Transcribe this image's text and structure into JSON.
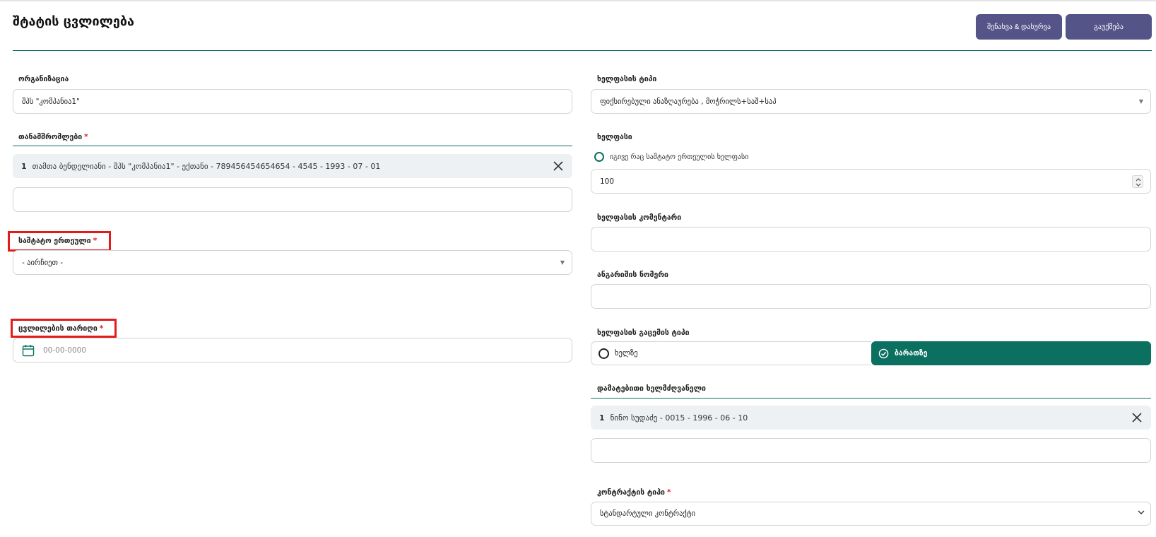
{
  "page": {
    "title": "შტატის ცვლილება",
    "save_button": "შენახვა & დახურვა",
    "cancel_button": "გაუქმება"
  },
  "left": {
    "organization": {
      "label": "ორგანიზაცია",
      "value": "შპს \"კომპანია1\""
    },
    "employees": {
      "label": "თანამშრომლები",
      "required_mark": "*",
      "selected": [
        {
          "index": "1",
          "text": "თამთა ბენდელიანი - შპს \"კომპანია1\" - ექთანი - 789456454654654 - 4545 - 1993 - 07 - 01"
        }
      ],
      "input_value": ""
    },
    "staff_unit": {
      "label": "საშტატო ერთეული",
      "required_mark": "*",
      "selected": "- აირჩიეთ -"
    },
    "change_date": {
      "label": "ცვლილების თარიღი",
      "required_mark": "*",
      "placeholder": "00-00-0000"
    }
  },
  "right": {
    "salary_type": {
      "label": "ხელფასის ტიპი",
      "selected": "ფიქსირებული ანაზღაურება , მოჭრილს+საშ+საპ"
    },
    "salary": {
      "label": "ხელფასი",
      "radio_label": "იგივე რაც საშტატო ერთეულის ხელფასი",
      "value": "100"
    },
    "salary_comment": {
      "label": "ხელფასის კომენტარი",
      "value": ""
    },
    "account_number": {
      "label": "ანგარიშის ნომერი",
      "value": ""
    },
    "payment_type": {
      "label": "ხელფასის გაცემის ტიპი",
      "options": [
        "ხელზე",
        "ბარათზე"
      ],
      "selected": "ბარათზე"
    },
    "additional_manager": {
      "label": "დამატებითი ხელმძღვანელი",
      "selected": [
        {
          "index": "1",
          "text": "ნინო სუდაძე - 0015 - 1996 - 06 - 10"
        }
      ],
      "input_value": ""
    },
    "contract_type": {
      "label": "კონტრაქტის ტიპი",
      "required_mark": "*",
      "selected": "სტანდარტული კონტრაქტი"
    }
  },
  "colors": {
    "accent": "#0b7060",
    "button": "#545489",
    "highlight": "#e31b1b",
    "required": "#e0202a"
  }
}
